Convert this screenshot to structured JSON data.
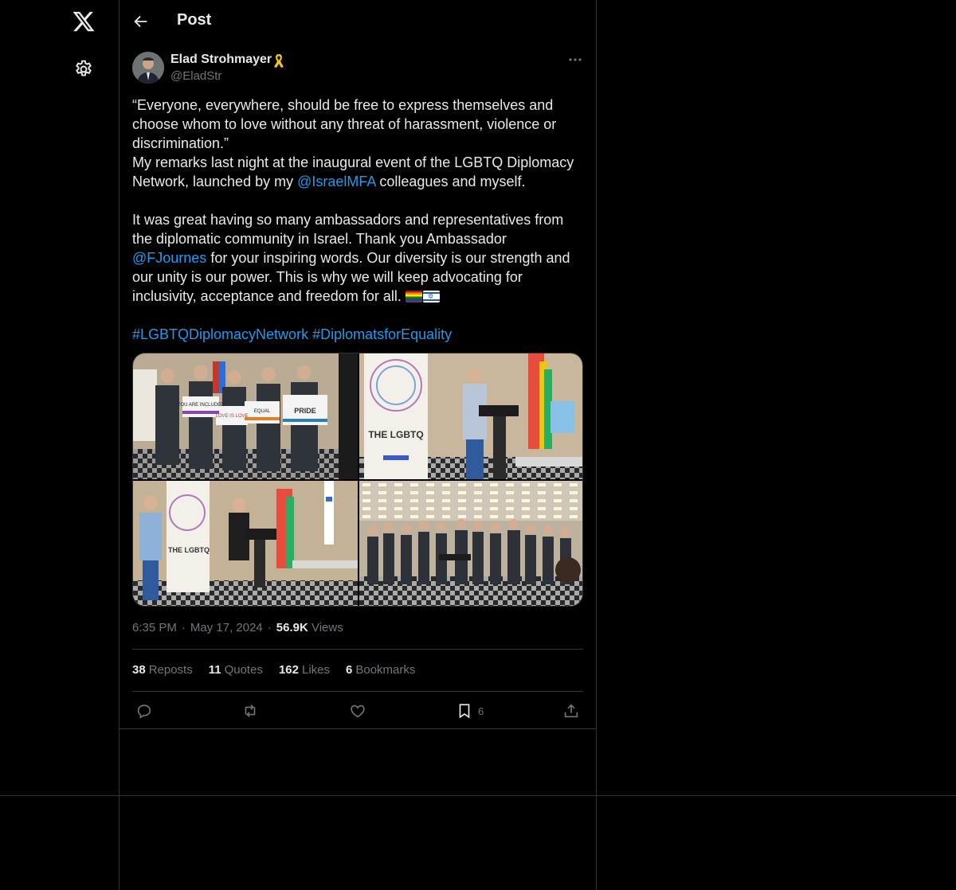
{
  "nav": {
    "logo_icon": "x-logo-icon",
    "settings_icon": "gear-icon"
  },
  "header": {
    "title": "Post",
    "back_icon": "arrow-left-icon"
  },
  "author": {
    "name": "Elad Strohmayer",
    "handle": "@EladStr",
    "badge_icon": "yellow-ribbon-icon"
  },
  "tweet": {
    "p1": "“Everyone, everywhere, should be free to express themselves and choose whom to love without any threat of harassment, violence or discrimination.”",
    "p2_a": "My remarks last night at the inaugural event of the LGBTQ Diplomacy Network, launched by my ",
    "p2_mention": "@IsraelMFA",
    "p2_b": " colleagues and myself.",
    "p3_a": "It was great having so many ambassadors and representatives from the diplomatic community in Israel. Thank you Ambassador ",
    "p3_mention": "@FJournes",
    "p3_b": " for your inspiring words. Our diversity is our strength and our unity is our power. This is why we will keep advocating for inclusivity, acceptance and freedom for all. ",
    "hashtag1": "#LGBTQDiplomacyNetwork",
    "hashtag2": "#DiplomatsforEquality"
  },
  "media": {
    "photo1": "Group holding signs",
    "photo2": "Speaker at podium",
    "photo3": "Speaker at podium with flags",
    "photo4": "Audience at event",
    "banner_text": "THE LGBTQ",
    "sign1": "YOU ARE INCLUDED",
    "sign2": "LOVE IS LOVE",
    "sign3": "EQUAL",
    "sign4": "PRIDE"
  },
  "meta": {
    "time": "6:35 PM",
    "date": "May 17, 2024",
    "views_count": "56.9K",
    "views_label": "Views",
    "separator": "·"
  },
  "stats": {
    "reposts_count": "38",
    "reposts_label": "Reposts",
    "quotes_count": "11",
    "quotes_label": "Quotes",
    "likes_count": "162",
    "likes_label": "Likes",
    "bookmarks_count": "6",
    "bookmarks_label": "Bookmarks"
  },
  "actions": {
    "bookmark_count": "6"
  },
  "colors": {
    "background": "#000000",
    "text": "#e7e9ea",
    "muted": "#71767b",
    "link": "#1d9bf0",
    "border": "#2f3336"
  }
}
